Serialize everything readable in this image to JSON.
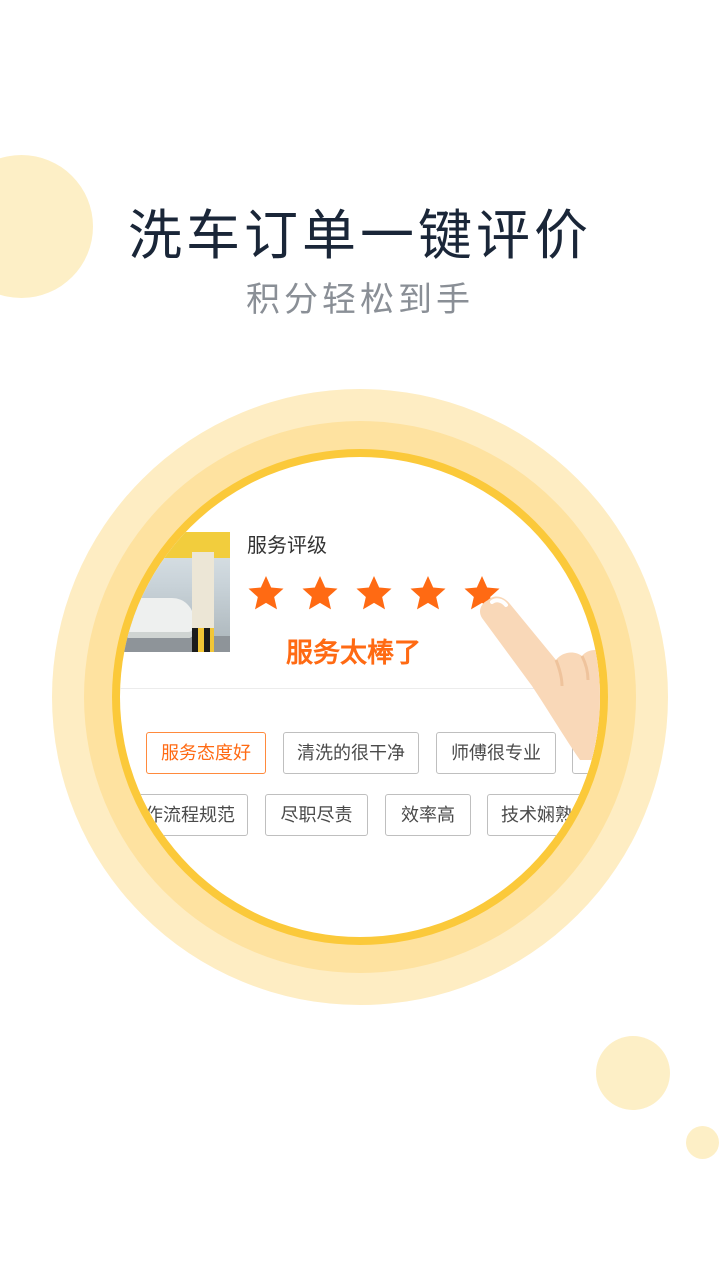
{
  "header": {
    "title": "洗车订单一键评价",
    "subtitle": "积分轻松到手"
  },
  "rating": {
    "label": "服务评级",
    "stars": 5,
    "max_stars": 5,
    "result_text": "服务太棒了"
  },
  "tags": {
    "row1": [
      "服务态度好",
      "清洗的很干净",
      "师傅很专业"
    ],
    "row2": [
      "作流程规范",
      "尽职尽责",
      "效率高",
      "技术娴熟"
    ],
    "selected": "服务态度好"
  },
  "colors": {
    "accent": "#ff6a13",
    "title": "#1a2638",
    "subtitle": "#8a8f96",
    "ring_outer": "#feedc3",
    "ring_mid": "#fee2a0",
    "ring_inner": "#fbc93a",
    "star": "#ff6a13"
  }
}
